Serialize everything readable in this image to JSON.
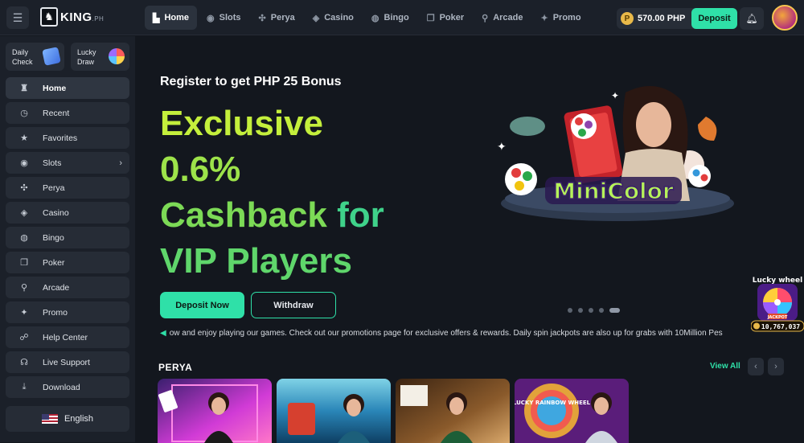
{
  "brand": {
    "name": "KING",
    "suffix": ".PH"
  },
  "nav": [
    {
      "label": "Home",
      "icon": "home-icon",
      "active": true
    },
    {
      "label": "Slots",
      "icon": "slots-icon"
    },
    {
      "label": "Perya",
      "icon": "perya-icon"
    },
    {
      "label": "Casino",
      "icon": "casino-icon"
    },
    {
      "label": "Bingo",
      "icon": "bingo-icon"
    },
    {
      "label": "Poker",
      "icon": "poker-icon"
    },
    {
      "label": "Arcade",
      "icon": "arcade-icon"
    },
    {
      "label": "Promo",
      "icon": "promo-icon"
    }
  ],
  "wallet": {
    "balance": "570.00 PHP",
    "coin_symbol": "P",
    "deposit_label": "Deposit"
  },
  "sidebar": {
    "quick": [
      {
        "line1": "Daily",
        "line2": "Check",
        "icon": "calendar-icon"
      },
      {
        "line1": "Lucky",
        "line2": "Draw",
        "icon": "wheel-icon"
      }
    ],
    "items": [
      {
        "label": "Home",
        "icon": "home-icon",
        "active": true
      },
      {
        "label": "Recent",
        "icon": "clock-icon"
      },
      {
        "label": "Favorites",
        "icon": "star-icon"
      },
      {
        "label": "Slots",
        "icon": "slots-icon",
        "has_chevron": true
      },
      {
        "label": "Perya",
        "icon": "perya-icon"
      },
      {
        "label": "Casino",
        "icon": "casino-icon"
      },
      {
        "label": "Bingo",
        "icon": "bingo-icon"
      },
      {
        "label": "Poker",
        "icon": "poker-icon"
      },
      {
        "label": "Arcade",
        "icon": "arcade-icon"
      },
      {
        "label": "Promo",
        "icon": "promo-icon"
      },
      {
        "label": "Help Center",
        "icon": "help-icon"
      },
      {
        "label": "Live Support",
        "icon": "headset-icon"
      },
      {
        "label": "Download",
        "icon": "download-icon"
      }
    ],
    "language": "English"
  },
  "hero": {
    "register_text": "Register to get PHP 25 Bonus",
    "headline": {
      "line1": "Exclusive",
      "line2": "0.6%",
      "line3a": "Cashback",
      "line3b": "for",
      "line4": "VIP Players"
    },
    "deposit_label": "Deposit Now",
    "withdraw_label": "Withdraw",
    "art_title": "MiniColor",
    "slides": 5,
    "active_slide": 5
  },
  "marquee": "ow and enjoy playing our games. Check out our promotions page for exclusive offers & rewards. Daily spin jackpots are also up for grabs with 10Million Pes",
  "lucky_wheel": {
    "title": "Lucky wheel",
    "badge": "JACKPOT",
    "amount": "10,767,037"
  },
  "section": {
    "title": "PERYA",
    "view_all": "View All"
  },
  "games": [
    {
      "colors": [
        "#3a1f6e",
        "#d13bd6",
        "#ff77c8"
      ]
    },
    {
      "colors": [
        "#0e3f63",
        "#2a86b8",
        "#7fd2e6"
      ]
    },
    {
      "colors": [
        "#3b2412",
        "#8a5a2b",
        "#d9a86b"
      ]
    },
    {
      "colors": [
        "#5a1d7a",
        "#e2a23a",
        "#f15b4f"
      ],
      "label": "LUCKY RAINBOW WHEEL"
    }
  ],
  "colors": {
    "accent": "#2fe0a8",
    "bg": "#13171e",
    "panel": "#1b2029"
  }
}
